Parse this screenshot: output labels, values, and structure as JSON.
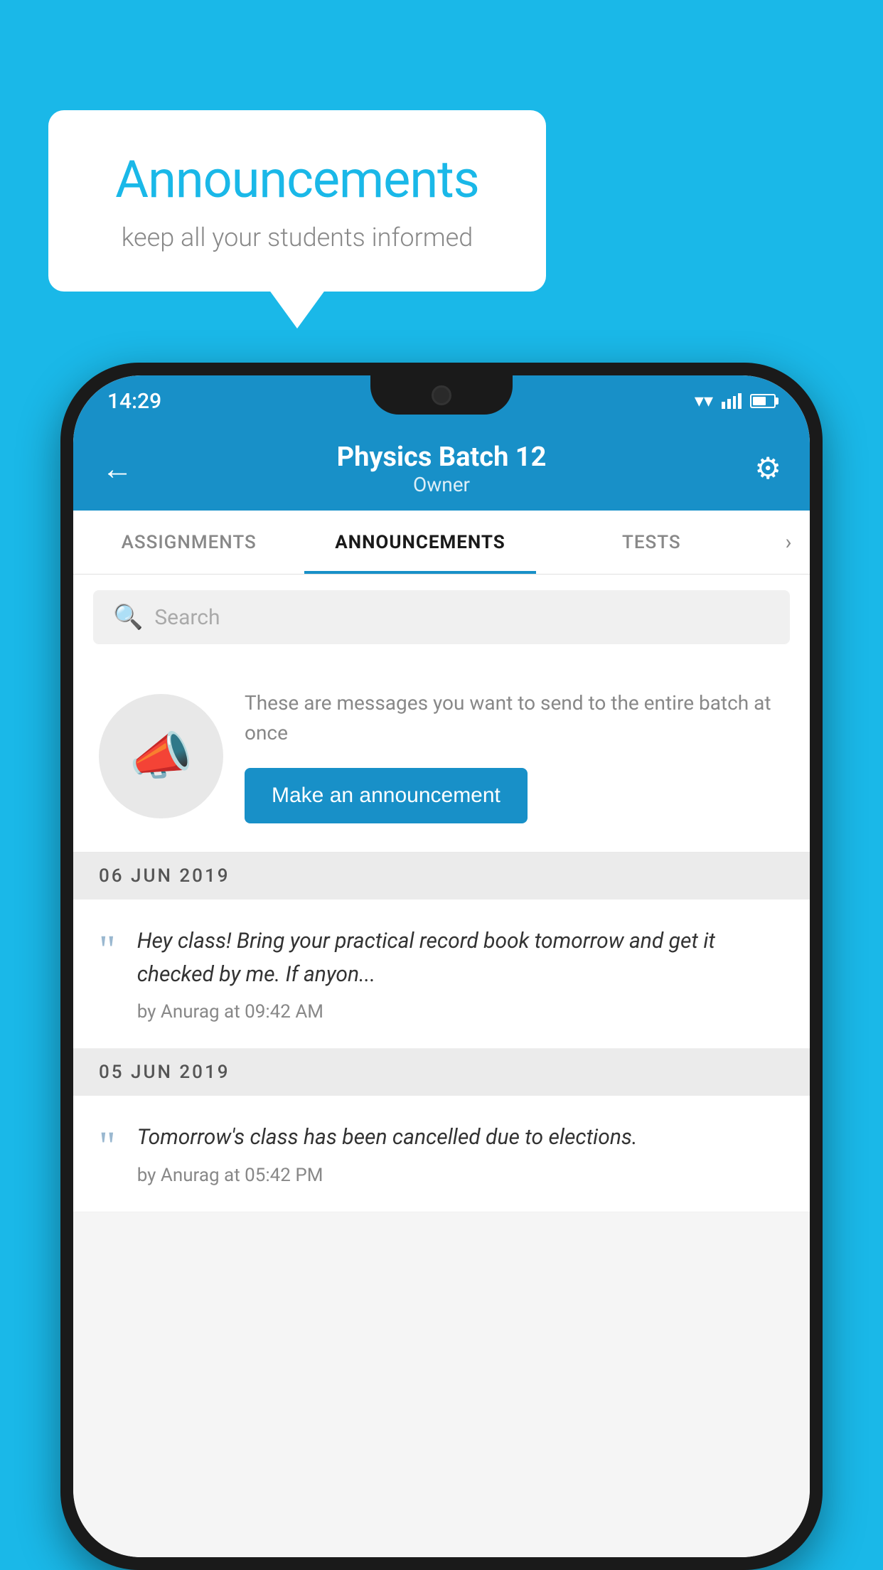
{
  "background_color": "#1ab8e8",
  "speech_bubble": {
    "title": "Announcements",
    "subtitle": "keep all your students informed"
  },
  "phone": {
    "status_bar": {
      "time": "14:29"
    },
    "app_bar": {
      "title": "Physics Batch 12",
      "subtitle": "Owner",
      "back_label": "←",
      "settings_label": "⚙"
    },
    "tabs": [
      {
        "label": "ASSIGNMENTS",
        "active": false
      },
      {
        "label": "ANNOUNCEMENTS",
        "active": true
      },
      {
        "label": "TESTS",
        "active": false
      }
    ],
    "search": {
      "placeholder": "Search"
    },
    "promo": {
      "description": "These are messages you want to send to the entire batch at once",
      "button_label": "Make an announcement"
    },
    "announcements": [
      {
        "date": "06  JUN  2019",
        "items": [
          {
            "text": "Hey class! Bring your practical record book tomorrow and get it checked by me. If anyon...",
            "meta": "by Anurag at 09:42 AM"
          }
        ]
      },
      {
        "date": "05  JUN  2019",
        "items": [
          {
            "text": "Tomorrow's class has been cancelled due to elections.",
            "meta": "by Anurag at 05:42 PM"
          }
        ]
      }
    ]
  }
}
